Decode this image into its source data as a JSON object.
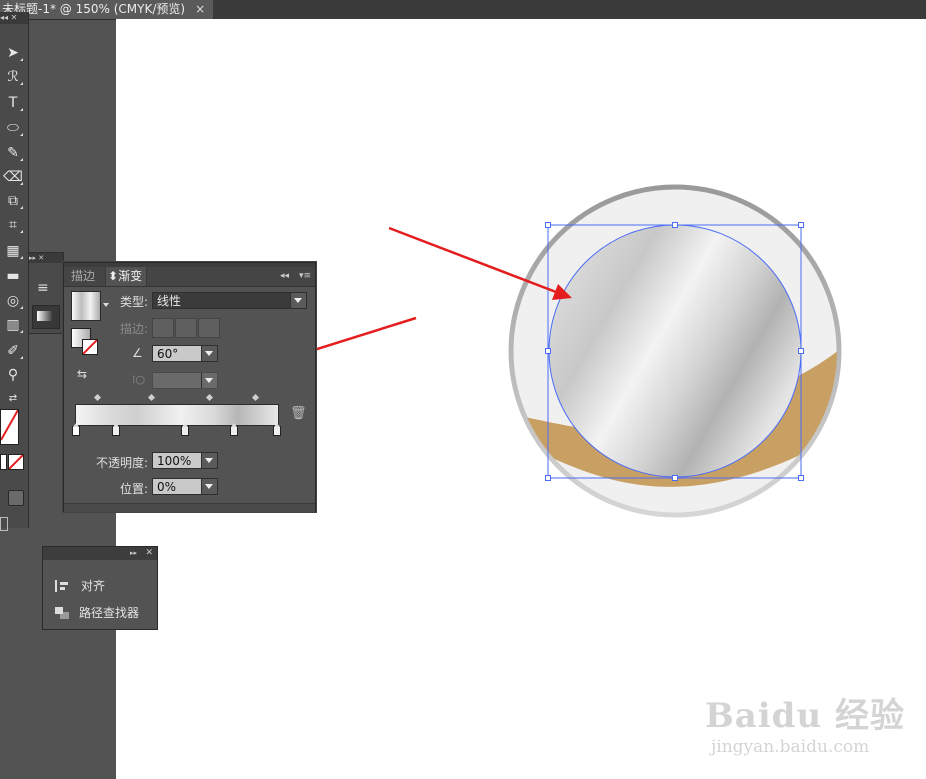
{
  "document_tab": {
    "title": "未标题-1* @ 150% (CMYK/预览)",
    "close": "×"
  },
  "panel_tabs": [
    "描边",
    "渐变"
  ],
  "gradient_panel": {
    "type_label": "类型:",
    "type_value": "线性",
    "stroke_label": "描边:",
    "angle_value": "60°",
    "aspect_value": "",
    "opacity_label": "不透明度:",
    "opacity_value": "100%",
    "location_label": "位置:",
    "location_value": "0%",
    "stops_count": 5
  },
  "align_panel": {
    "items": [
      "对齐",
      "路径查找器"
    ]
  },
  "watermark": {
    "brand": "Baidu 经验",
    "url": "jingyan.baidu.com"
  },
  "colors": {
    "ui_bg": "#535353",
    "canvas": "#ffffff",
    "selection": "#4a6cf7",
    "arrow": "#e41e1e",
    "tan_band": "#c9a063"
  }
}
